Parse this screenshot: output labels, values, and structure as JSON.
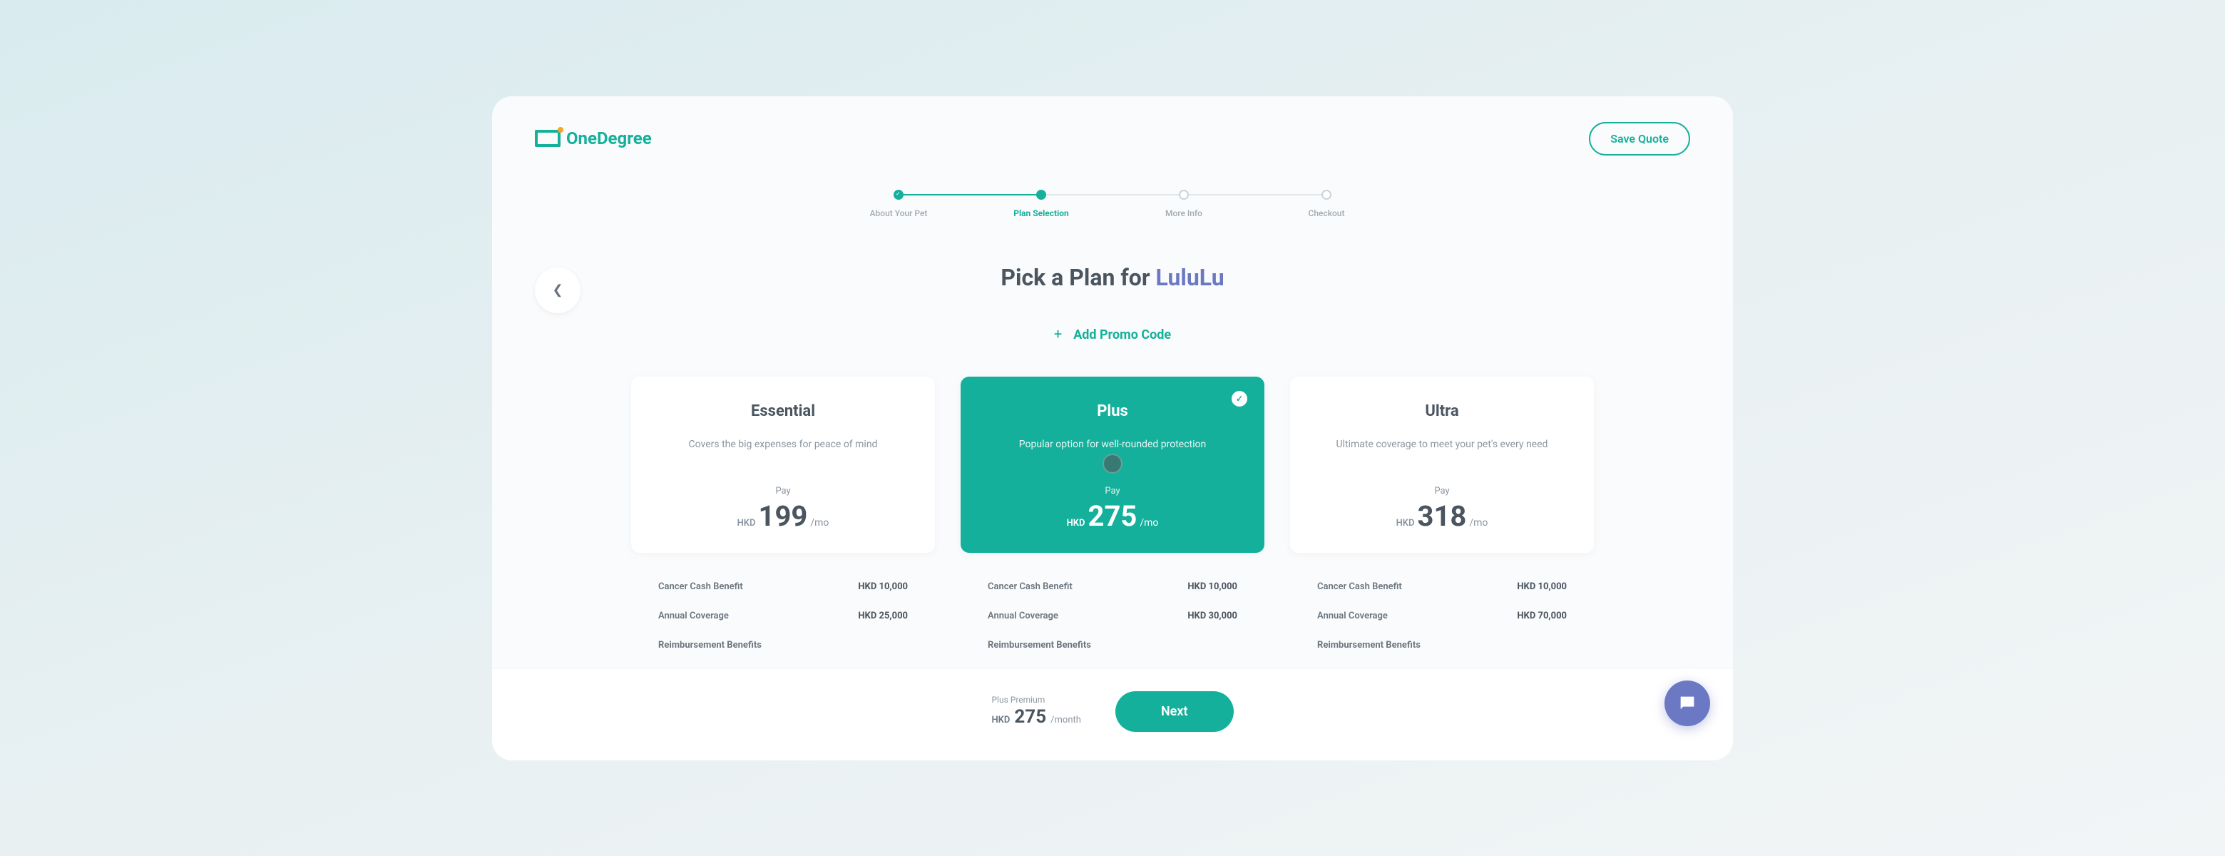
{
  "brand": "OneDegree",
  "header": {
    "save_quote": "Save Quote"
  },
  "stepper": {
    "steps": [
      {
        "label": "About Your Pet",
        "state": "done"
      },
      {
        "label": "Plan Selection",
        "state": "active"
      },
      {
        "label": "More Info",
        "state": "future"
      },
      {
        "label": "Checkout",
        "state": "future"
      }
    ]
  },
  "title_prefix": "Pick a Plan for ",
  "pet_name": "LuluLu",
  "promo_label": "Add Promo Code",
  "pay_label": "Pay",
  "price_suffix": "/mo",
  "currency": "HKD",
  "plans": [
    {
      "name": "Essential",
      "desc": "Covers the big expenses for peace of mind",
      "price": "199",
      "selected": false
    },
    {
      "name": "Plus",
      "desc": "Popular option for well-rounded protection",
      "price": "275",
      "selected": true
    },
    {
      "name": "Ultra",
      "desc": "Ultimate coverage to meet your pet's every need",
      "price": "318",
      "selected": false
    }
  ],
  "details": {
    "rows": [
      {
        "label": "Cancer Cash Benefit",
        "values": [
          "HKD 10,000",
          "HKD 10,000",
          "HKD 10,000"
        ]
      },
      {
        "label": "Annual Coverage",
        "values": [
          "HKD 25,000",
          "HKD 30,000",
          "HKD 70,000"
        ]
      }
    ],
    "section": "Reimbursement Benefits"
  },
  "footer": {
    "plan_label": "Plus Premium",
    "currency": "HKD",
    "price": "275",
    "suffix": "/month",
    "next": "Next"
  }
}
